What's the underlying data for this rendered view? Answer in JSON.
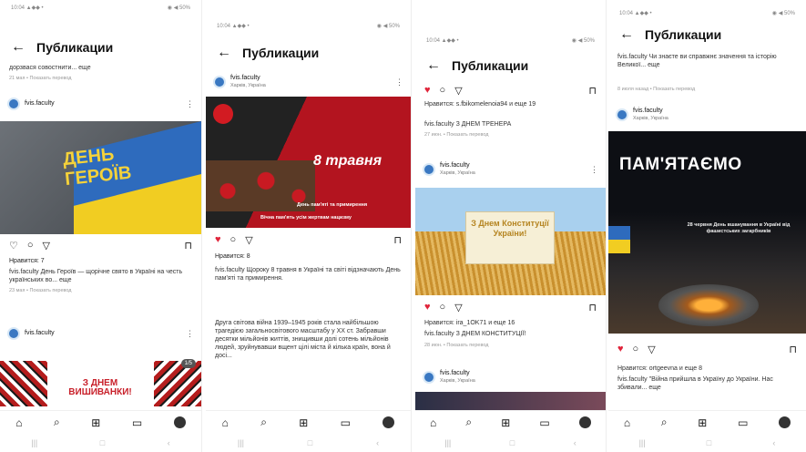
{
  "common": {
    "status_left": "10:04 ▲◆◆ •",
    "status_right": "◉ ◀ 50%",
    "title": "Публикации",
    "back": "←",
    "nav_icons": [
      "⌂",
      "⌕",
      "⊞",
      "▭",
      "●"
    ],
    "sys_icons": [
      "|||",
      "□",
      "‹"
    ]
  },
  "phone1": {
    "cap_top": "дорзвася совостнити... еще",
    "meta_top": "21 мая • Показать перевод",
    "profile": "fvis.faculty",
    "image_text": "ДЕНЬ ГЕРОЇВ",
    "likes": "Нравится: 7",
    "caption": "fvis.faculty День Героїв — щорічне свято в Україні на честь українських во... еще",
    "meta": "23 мая • Показать перевод",
    "profile2": "fvis.faculty",
    "image2_text": "З ДНЕМ ВИШИВАНКИ!",
    "page_counter": "1/5"
  },
  "phone2": {
    "profile": "fvis.faculty",
    "location": "Харків, Україна",
    "image_text": "8 травня",
    "image_sub": "День пам'яті та примирення",
    "image_sub2": "Вічна пам'ять усім жертвам нацизму",
    "likes": "Нравится: 8",
    "caption": "fvis.faculty Щороку 8 травня в Україні та світі відзначають День пам'яті та примирення.",
    "caption2": "Друга світова війна 1939–1945 років стала найбільшою трагедією загальносвітового масштабу у XX ст. Забравши десятки мільйонів життів, знищивши долі сотень мільйонів людей, зруйнувавши вщент цілі міста й кілька країн, вона й досі..."
  },
  "phone3": {
    "liked_by": "Нравится: s.fbikomelenoia94 и еще 19",
    "caption": "fvis.faculty З ДНЕМ ТРЕНЕРА",
    "meta": "27 июн. • Показать перевод",
    "profile": "fvis.faculty",
    "location": "Харків, Україна",
    "image_text": "З Днем Конституції України!",
    "liked_by2": "Нравится: ira_1OK71 и еще 16",
    "caption2": "fvis.faculty З ДНЕМ КОНСТИТУЦІЇ!",
    "meta2": "28 июн. • Показать перевод",
    "profile2": "fvis.faculty",
    "location2": "Харків, Україна"
  },
  "phone4": {
    "cap_top": "fvis.faculty Чи знаєте ви справжнє значення та історію Великої... еще",
    "meta_top": "8 июля назад • Показать перевод",
    "profile": "fvis.faculty",
    "location": "Харків, Україна",
    "image_text": "ПАМ'ЯТАЄМО",
    "image_sub": "28 червня День вшанування в Україні від фашистських загарбників",
    "liked_by": "Нравится: ortgeevna и еще 8",
    "caption": "fvis.faculty \"Війна прийшла в Україну до України. Нас збивали... еще"
  }
}
